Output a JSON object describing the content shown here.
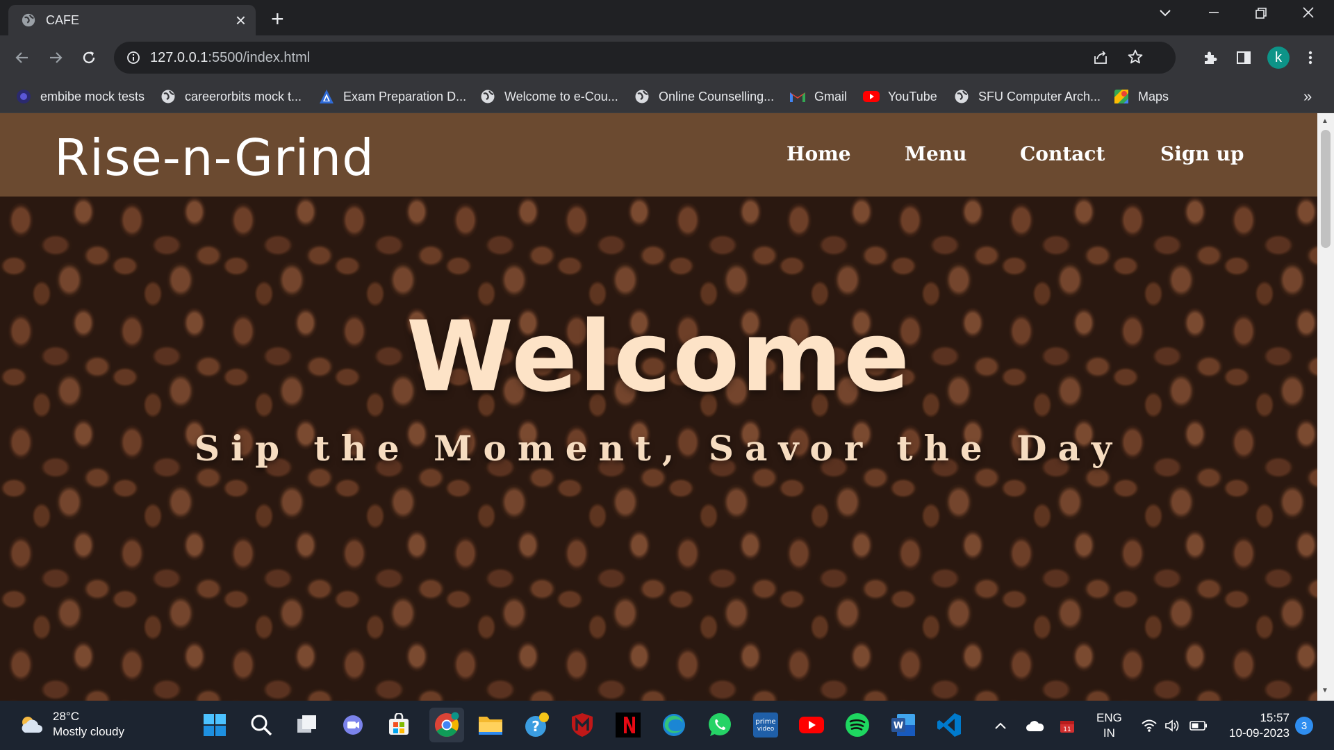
{
  "browser": {
    "tab": {
      "title": "CAFE"
    },
    "address": {
      "host": "127.0.0.1",
      "rest": ":5500/index.html"
    },
    "profile_initial": "k",
    "bookmarks": [
      {
        "label": "embibe mock tests",
        "icon": "embibe-icon"
      },
      {
        "label": "careerorbits mock t...",
        "icon": "globe-icon"
      },
      {
        "label": "Exam Preparation D...",
        "icon": "exam-app-icon"
      },
      {
        "label": "Welcome to e-Cou...",
        "icon": "globe-icon"
      },
      {
        "label": "Online Counselling...",
        "icon": "globe-icon"
      },
      {
        "label": "Gmail",
        "icon": "gmail-icon"
      },
      {
        "label": "YouTube",
        "icon": "youtube-icon"
      },
      {
        "label": "SFU Computer Arch...",
        "icon": "globe-icon"
      },
      {
        "label": "Maps",
        "icon": "maps-icon"
      }
    ],
    "more_bookmarks": "»"
  },
  "site": {
    "logo": "Rise-n-Grind",
    "nav": [
      "Home",
      "Menu",
      "Contact",
      "Sign up"
    ],
    "hero_title": "Welcome",
    "hero_tagline": "Sip the Moment, Savor the Day",
    "colors": {
      "nav_bg": "#6b4a30",
      "hero_text": "#fde3c7"
    }
  },
  "taskbar": {
    "weather": {
      "temp": "28°C",
      "condition": "Mostly cloudy"
    },
    "apps": [
      "start-icon",
      "search-icon",
      "task-view-icon",
      "teams-chat-icon",
      "store-icon",
      "chrome-icon",
      "file-explorer-icon",
      "help-icon",
      "mcafee-icon",
      "netflix-icon",
      "edge-icon",
      "whatsapp-icon",
      "prime-video-icon",
      "youtube-icon",
      "spotify-icon",
      "word-icon",
      "vscode-icon"
    ],
    "language": {
      "line1": "ENG",
      "line2": "IN"
    },
    "clock": {
      "time": "15:57",
      "date": "10-09-2023"
    },
    "notification_count": "3"
  }
}
